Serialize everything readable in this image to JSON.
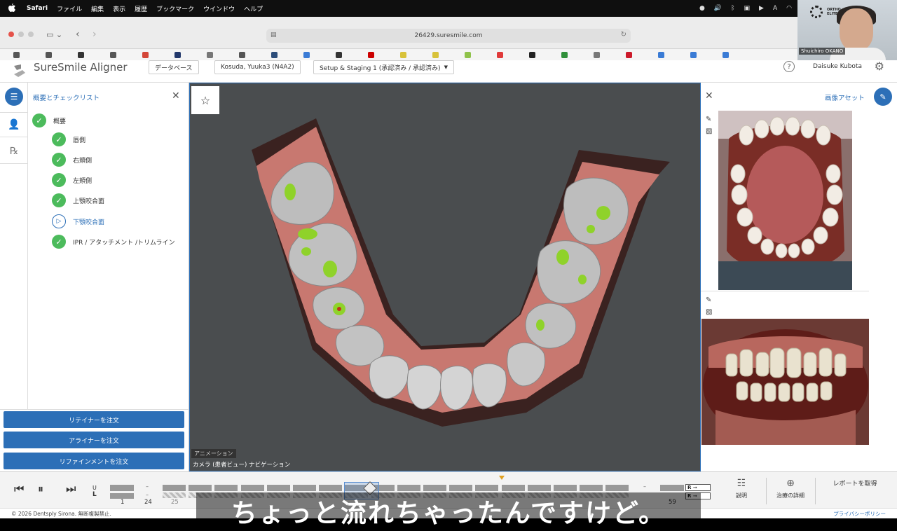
{
  "menubar": {
    "app": "Safari",
    "items": [
      "ファイル",
      "編集",
      "表示",
      "履歴",
      "ブックマーク",
      "ウインドウ",
      "ヘルプ"
    ],
    "status_icons": [
      "record-icon",
      "volume-icon",
      "bluetooth-icon",
      "pdf-icon",
      "play-icon",
      "input-icon",
      "wifi-icon"
    ]
  },
  "browser": {
    "url": "26429.suresmile.com",
    "bookmark_colors": [
      "#555555",
      "#555555",
      "#333333",
      "#555555",
      "#d44638",
      "#22386b",
      "#777777",
      "#555555",
      "#2c4d7a",
      "#3a7bd5",
      "#333333",
      "#cc0000",
      "#d8c23a",
      "#d8c23a",
      "#8fc24a",
      "#e03a3a",
      "#222222",
      "#2f8f3a",
      "#777777",
      "#cc1a2a",
      "#3a7bd5",
      "#3a7bd5",
      "#3a7bd5"
    ]
  },
  "webcam": {
    "brand": "ORTHO\nELITE",
    "name": "Shuichiro OKANO"
  },
  "header": {
    "logo": "SureSmile Aligner",
    "database_btn": "データベース",
    "patient_btn": "Kosuda, Yuuka3 (N4A2)",
    "setup_btn": "Setup & Staging 1 (承認済み / 承認済み)",
    "user": "Daisuke Kubota"
  },
  "left_panel": {
    "title": "概要とチェックリスト",
    "items": [
      {
        "label": "概要",
        "state": "done"
      },
      {
        "label": "唇側",
        "state": "done"
      },
      {
        "label": "右頬側",
        "state": "done"
      },
      {
        "label": "左頬側",
        "state": "done"
      },
      {
        "label": "上顎咬合面",
        "state": "done"
      },
      {
        "label": "下顎咬合面",
        "state": "active"
      },
      {
        "label": "IPR / アタッチメント /トリムライン",
        "state": "done"
      }
    ],
    "buttons": [
      "リテイナーを注文",
      "アライナーを注文",
      "リファインメントを注文"
    ]
  },
  "viewer": {
    "animation_label": "アニメーション",
    "camera_label": "カメラ (患者ビュー) ナビゲーション"
  },
  "right_panel": {
    "title": "画像アセット"
  },
  "timeline": {
    "upper_letter": "U",
    "lower_letter": "L",
    "start_stage": "1",
    "stage_24": "24",
    "stage_25": "25",
    "end_stage": "59",
    "r_label_1": "R",
    "r_label_2": "R",
    "dash_1": "–",
    "dash_2": "–",
    "dash_3": "–",
    "explain_label": "説明",
    "treatment_label": "治療の詳細",
    "report_label": "レポートを取得"
  },
  "footer": {
    "copyright": "© 2026 Dentsply Sirona. 無断複製禁止.",
    "privacy": "プライバシーポリシー"
  },
  "subtitle": "ちょっと流れちゃったんですけど。"
}
